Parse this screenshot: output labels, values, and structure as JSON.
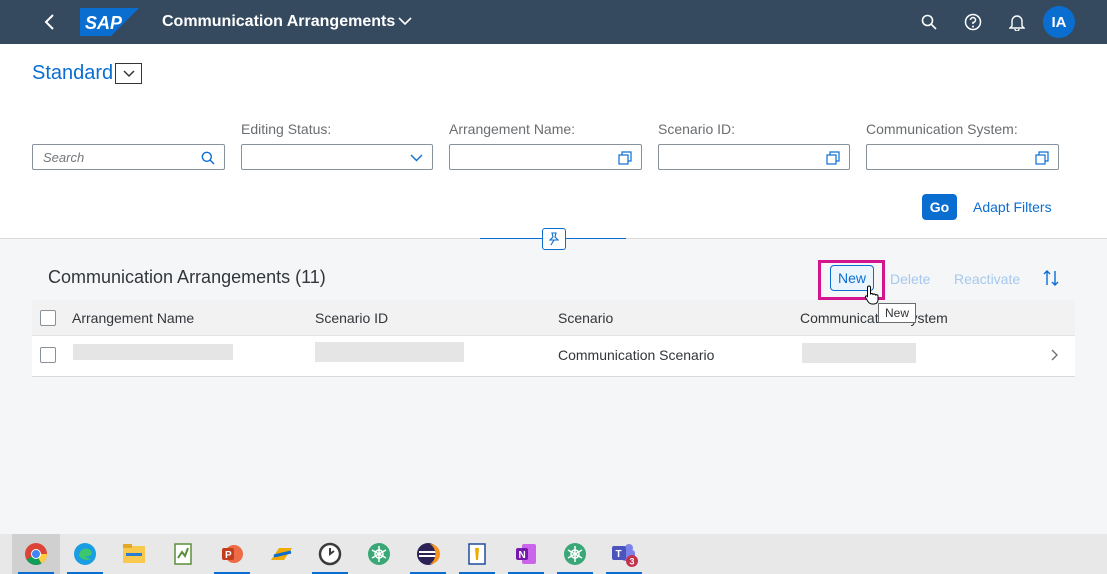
{
  "shell": {
    "logo": "SAP",
    "title": "Communication Arrangements",
    "user_initials": "IA",
    "icons": [
      "back-icon",
      "chevron-down-icon",
      "search-icon",
      "help-icon",
      "bell-icon"
    ]
  },
  "header": {
    "variant": "Standard",
    "search_placeholder": "Search",
    "filters": [
      {
        "label": "Editing Status:",
        "value": ""
      },
      {
        "label": "Arrangement Name:",
        "value": ""
      },
      {
        "label": "Scenario ID:",
        "value": ""
      },
      {
        "label": "Communication System:",
        "value": ""
      }
    ],
    "go_label": "Go",
    "adapt_filters_label": "Adapt Filters"
  },
  "table": {
    "title": "Communication Arrangements (11)",
    "toolbar": {
      "new": "New",
      "delete": "Delete",
      "reactivate": "Reactivate"
    },
    "tooltip": "New",
    "columns": [
      "Arrangement Name",
      "Scenario ID",
      "Scenario",
      "Communication System"
    ],
    "rows": [
      {
        "arrangement_name": "",
        "scenario_id": "",
        "scenario": "Communication Scenario",
        "communication_system": ""
      }
    ]
  },
  "colors": {
    "shell_bg": "#354a5f",
    "accent": "#0a6ed1",
    "highlight": "#d4138f"
  },
  "taskbar": {
    "apps": [
      "chrome-icon",
      "edge-icon",
      "file-explorer-icon",
      "notepad-icon",
      "powerpoint-icon",
      "sap-gui-icon",
      "clock-icon",
      "app-icon",
      "eclipse-icon",
      "document-icon",
      "onenote-icon",
      "app-icon",
      "teams-icon"
    ],
    "teams_badge": "3"
  }
}
